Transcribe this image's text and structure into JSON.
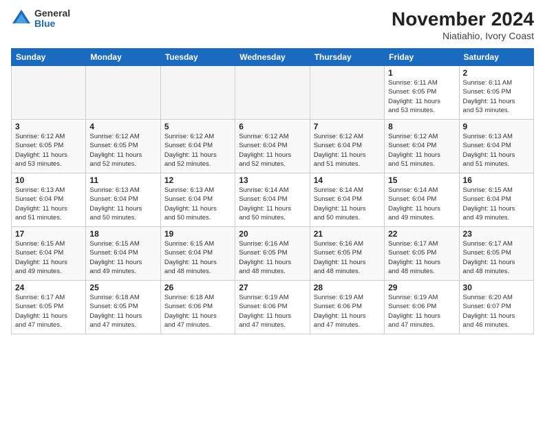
{
  "logo": {
    "general": "General",
    "blue": "Blue"
  },
  "title": "November 2024",
  "location": "Niatiahio, Ivory Coast",
  "days_header": [
    "Sunday",
    "Monday",
    "Tuesday",
    "Wednesday",
    "Thursday",
    "Friday",
    "Saturday"
  ],
  "weeks": [
    [
      {
        "day": "",
        "info": ""
      },
      {
        "day": "",
        "info": ""
      },
      {
        "day": "",
        "info": ""
      },
      {
        "day": "",
        "info": ""
      },
      {
        "day": "",
        "info": ""
      },
      {
        "day": "1",
        "info": "Sunrise: 6:11 AM\nSunset: 6:05 PM\nDaylight: 11 hours\nand 53 minutes."
      },
      {
        "day": "2",
        "info": "Sunrise: 6:11 AM\nSunset: 6:05 PM\nDaylight: 11 hours\nand 53 minutes."
      }
    ],
    [
      {
        "day": "3",
        "info": "Sunrise: 6:12 AM\nSunset: 6:05 PM\nDaylight: 11 hours\nand 53 minutes."
      },
      {
        "day": "4",
        "info": "Sunrise: 6:12 AM\nSunset: 6:05 PM\nDaylight: 11 hours\nand 52 minutes."
      },
      {
        "day": "5",
        "info": "Sunrise: 6:12 AM\nSunset: 6:04 PM\nDaylight: 11 hours\nand 52 minutes."
      },
      {
        "day": "6",
        "info": "Sunrise: 6:12 AM\nSunset: 6:04 PM\nDaylight: 11 hours\nand 52 minutes."
      },
      {
        "day": "7",
        "info": "Sunrise: 6:12 AM\nSunset: 6:04 PM\nDaylight: 11 hours\nand 51 minutes."
      },
      {
        "day": "8",
        "info": "Sunrise: 6:12 AM\nSunset: 6:04 PM\nDaylight: 11 hours\nand 51 minutes."
      },
      {
        "day": "9",
        "info": "Sunrise: 6:13 AM\nSunset: 6:04 PM\nDaylight: 11 hours\nand 51 minutes."
      }
    ],
    [
      {
        "day": "10",
        "info": "Sunrise: 6:13 AM\nSunset: 6:04 PM\nDaylight: 11 hours\nand 51 minutes."
      },
      {
        "day": "11",
        "info": "Sunrise: 6:13 AM\nSunset: 6:04 PM\nDaylight: 11 hours\nand 50 minutes."
      },
      {
        "day": "12",
        "info": "Sunrise: 6:13 AM\nSunset: 6:04 PM\nDaylight: 11 hours\nand 50 minutes."
      },
      {
        "day": "13",
        "info": "Sunrise: 6:14 AM\nSunset: 6:04 PM\nDaylight: 11 hours\nand 50 minutes."
      },
      {
        "day": "14",
        "info": "Sunrise: 6:14 AM\nSunset: 6:04 PM\nDaylight: 11 hours\nand 50 minutes."
      },
      {
        "day": "15",
        "info": "Sunrise: 6:14 AM\nSunset: 6:04 PM\nDaylight: 11 hours\nand 49 minutes."
      },
      {
        "day": "16",
        "info": "Sunrise: 6:15 AM\nSunset: 6:04 PM\nDaylight: 11 hours\nand 49 minutes."
      }
    ],
    [
      {
        "day": "17",
        "info": "Sunrise: 6:15 AM\nSunset: 6:04 PM\nDaylight: 11 hours\nand 49 minutes."
      },
      {
        "day": "18",
        "info": "Sunrise: 6:15 AM\nSunset: 6:04 PM\nDaylight: 11 hours\nand 49 minutes."
      },
      {
        "day": "19",
        "info": "Sunrise: 6:15 AM\nSunset: 6:04 PM\nDaylight: 11 hours\nand 48 minutes."
      },
      {
        "day": "20",
        "info": "Sunrise: 6:16 AM\nSunset: 6:05 PM\nDaylight: 11 hours\nand 48 minutes."
      },
      {
        "day": "21",
        "info": "Sunrise: 6:16 AM\nSunset: 6:05 PM\nDaylight: 11 hours\nand 48 minutes."
      },
      {
        "day": "22",
        "info": "Sunrise: 6:17 AM\nSunset: 6:05 PM\nDaylight: 11 hours\nand 48 minutes."
      },
      {
        "day": "23",
        "info": "Sunrise: 6:17 AM\nSunset: 6:05 PM\nDaylight: 11 hours\nand 48 minutes."
      }
    ],
    [
      {
        "day": "24",
        "info": "Sunrise: 6:17 AM\nSunset: 6:05 PM\nDaylight: 11 hours\nand 47 minutes."
      },
      {
        "day": "25",
        "info": "Sunrise: 6:18 AM\nSunset: 6:05 PM\nDaylight: 11 hours\nand 47 minutes."
      },
      {
        "day": "26",
        "info": "Sunrise: 6:18 AM\nSunset: 6:06 PM\nDaylight: 11 hours\nand 47 minutes."
      },
      {
        "day": "27",
        "info": "Sunrise: 6:19 AM\nSunset: 6:06 PM\nDaylight: 11 hours\nand 47 minutes."
      },
      {
        "day": "28",
        "info": "Sunrise: 6:19 AM\nSunset: 6:06 PM\nDaylight: 11 hours\nand 47 minutes."
      },
      {
        "day": "29",
        "info": "Sunrise: 6:19 AM\nSunset: 6:06 PM\nDaylight: 11 hours\nand 47 minutes."
      },
      {
        "day": "30",
        "info": "Sunrise: 6:20 AM\nSunset: 6:07 PM\nDaylight: 11 hours\nand 46 minutes."
      }
    ]
  ]
}
